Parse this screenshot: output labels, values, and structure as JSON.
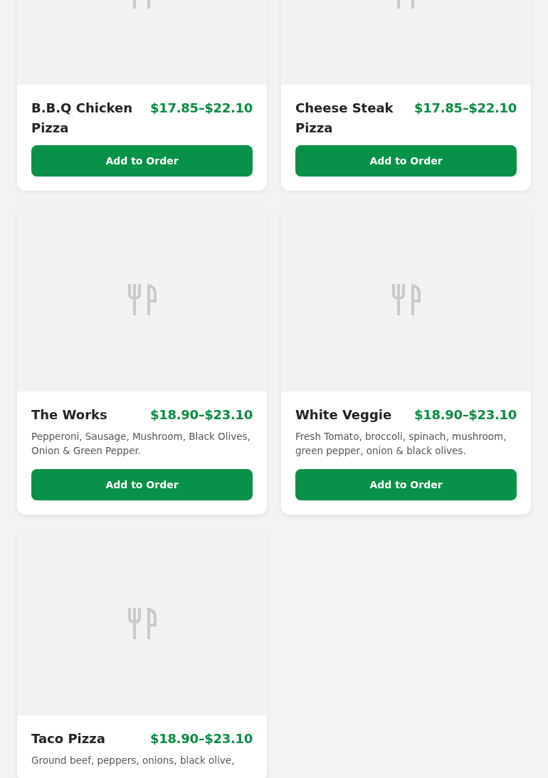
{
  "menu_items": [
    {
      "name": "B.B.Q Chicken Pizza",
      "price": "$17.85–$22.10",
      "button": "Add to Order"
    },
    {
      "name": "Cheese Steak Pizza",
      "price": "$17.85–$22.10",
      "button": "Add to Order"
    },
    {
      "name": "The Works",
      "price": "$18.90–$23.10",
      "description": "Pepperoni, Sausage, Mushroom, Black Olives, Onion & Green Pepper.",
      "button": "Add to Order"
    },
    {
      "name": "White Veggie",
      "price": "$18.90–$23.10",
      "description": "Fresh Tomato, broccoli, spinach, mushroom, green pepper, onion & black olives.",
      "button": "Add to Order"
    },
    {
      "name": "Taco Pizza",
      "price": "$18.90–$23.10",
      "description": "Ground beef, peppers, onions, black olive,"
    }
  ]
}
